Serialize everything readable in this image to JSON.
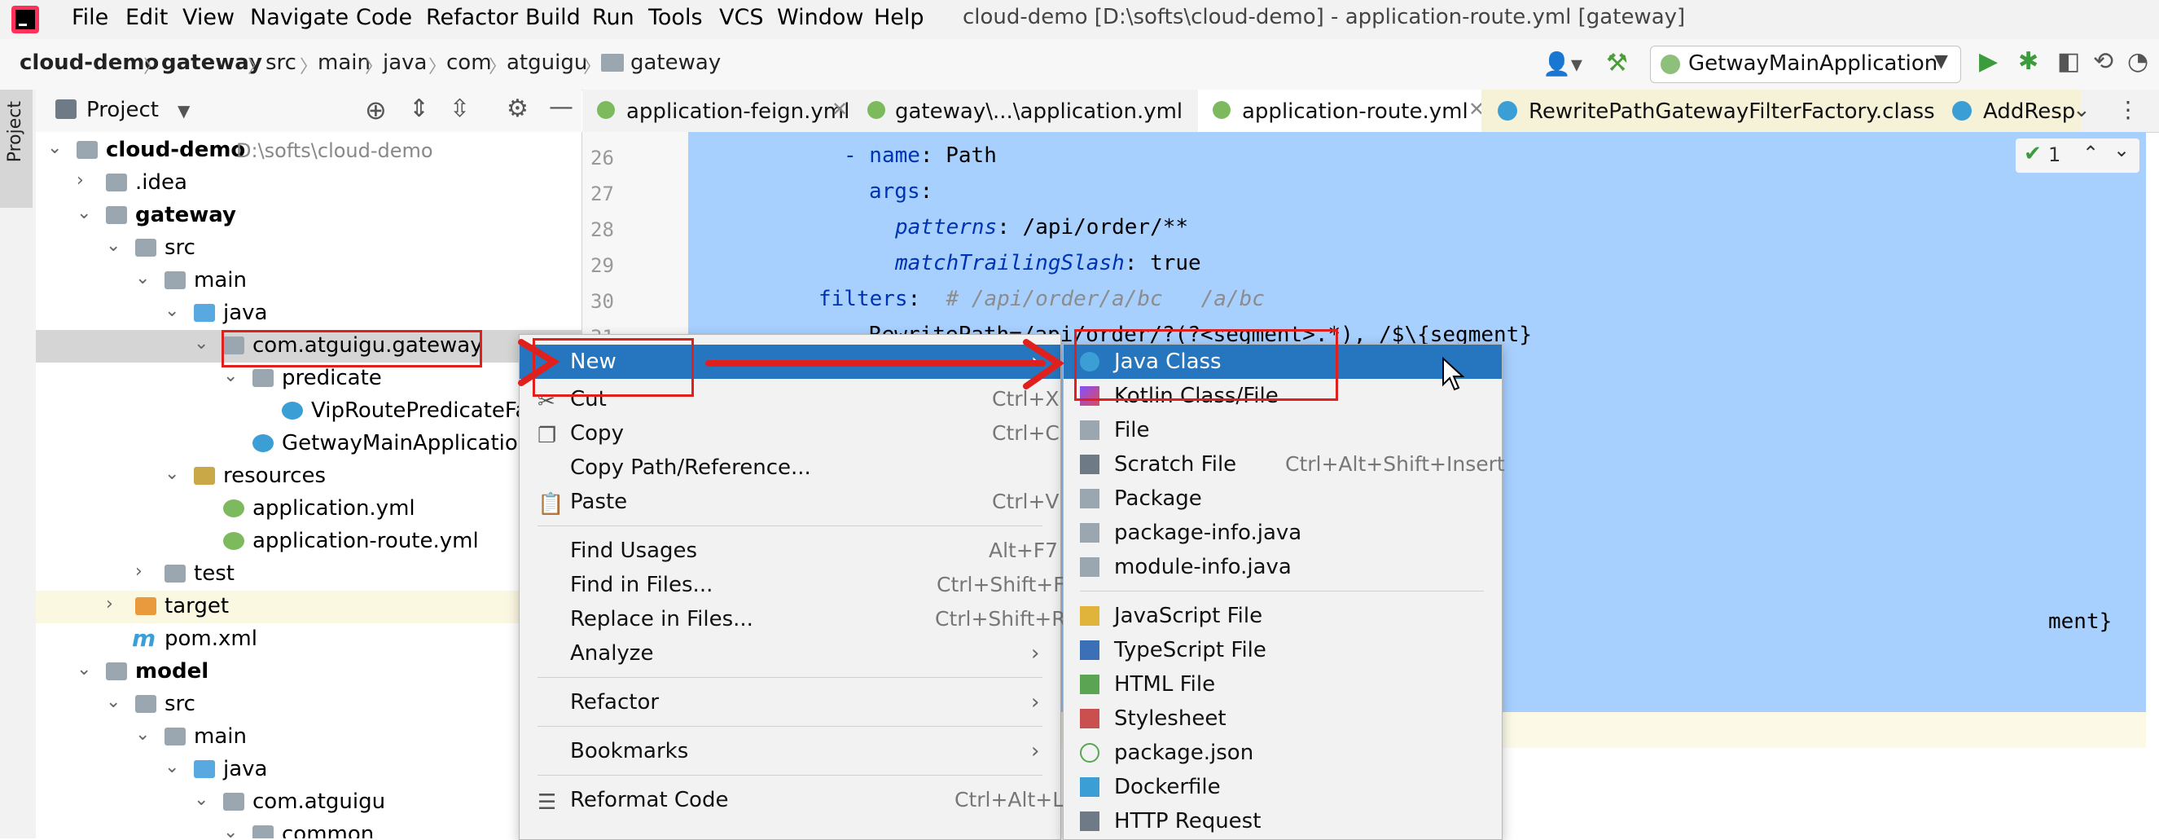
{
  "menubar": {
    "items": [
      "File",
      "Edit",
      "View",
      "Navigate",
      "Code",
      "Refactor",
      "Build",
      "Run",
      "Tools",
      "VCS",
      "Window",
      "Help"
    ],
    "title": "cloud-demo [D:\\softs\\cloud-demo] - application-route.yml [gateway]"
  },
  "breadcrumb": [
    "cloud-demo",
    "gateway",
    "src",
    "main",
    "java",
    "com",
    "atguigu",
    "gateway"
  ],
  "run_config": "GetwayMainApplication",
  "stripe_label": "Project",
  "project_header": "Project",
  "tree": [
    {
      "label": "cloud-demo",
      "hint": "D:\\softs\\cloud-demo"
    },
    {
      "label": ".idea"
    },
    {
      "label": "gateway"
    },
    {
      "label": "src"
    },
    {
      "label": "main"
    },
    {
      "label": "java"
    },
    {
      "label": "com.atguigu.gateway"
    },
    {
      "label": "predicate"
    },
    {
      "label": "VipRoutePredicateFact"
    },
    {
      "label": "GetwayMainApplication"
    },
    {
      "label": "resources"
    },
    {
      "label": "application.yml"
    },
    {
      "label": "application-route.yml"
    },
    {
      "label": "test"
    },
    {
      "label": "target"
    },
    {
      "label": "pom.xml"
    },
    {
      "label": "model"
    },
    {
      "label": "src"
    },
    {
      "label": "main"
    },
    {
      "label": "java"
    },
    {
      "label": "com.atguigu"
    },
    {
      "label": "common"
    }
  ],
  "tabs": [
    "application-feign.yml",
    "gateway\\...\\application.yml",
    "application-route.yml",
    "RewritePathGatewayFilterFactory.class",
    "AddResp"
  ],
  "inspection_count": "1",
  "line_numbers": [
    "26",
    "27",
    "28",
    "29",
    "30",
    "31"
  ],
  "code": {
    "l26_key": "- name",
    "l26_val": ": Path",
    "l27_key": "args",
    "l27_val": ":",
    "l28_key": "patterns",
    "l28_val": ": /api/order/**",
    "l29_key": "matchTrailingSlash",
    "l29_val": ": true",
    "l30_key": "filters",
    "l30_val": ":",
    "l30_comment": "# /api/order/a/bc   /a/bc",
    "l31": "RewritePath=/api/order/?(?<segment>.*), /$\\{segment}",
    "frag2": "ment}"
  },
  "context_menu": {
    "new": "New",
    "cut": "Cut",
    "cut_sc": "Ctrl+X",
    "copy": "Copy",
    "copy_sc": "Ctrl+C",
    "copy_path": "Copy Path/Reference...",
    "paste": "Paste",
    "paste_sc": "Ctrl+V",
    "find_usages": "Find Usages",
    "find_usages_sc": "Alt+F7",
    "find_in_files": "Find in Files...",
    "find_in_files_sc": "Ctrl+Shift+F",
    "replace_in_files": "Replace in Files...",
    "replace_in_files_sc": "Ctrl+Shift+R",
    "analyze": "Analyze",
    "refactor": "Refactor",
    "bookmarks": "Bookmarks",
    "reformat": "Reformat Code",
    "reformat_sc": "Ctrl+Alt+L"
  },
  "new_menu": {
    "java_class": "Java Class",
    "kotlin": "Kotlin Class/File",
    "file": "File",
    "scratch": "Scratch File",
    "scratch_sc": "Ctrl+Alt+Shift+Insert",
    "package": "Package",
    "package_info": "package-info.java",
    "module_info": "module-info.java",
    "js": "JavaScript File",
    "ts": "TypeScript File",
    "html": "HTML File",
    "stylesheet": "Stylesheet",
    "package_json": "package.json",
    "dockerfile": "Dockerfile",
    "http": "HTTP Request"
  },
  "colors": {
    "accent": "#2675bf",
    "selection": "#a7d0ff",
    "annotation_red": "#e0201c"
  }
}
